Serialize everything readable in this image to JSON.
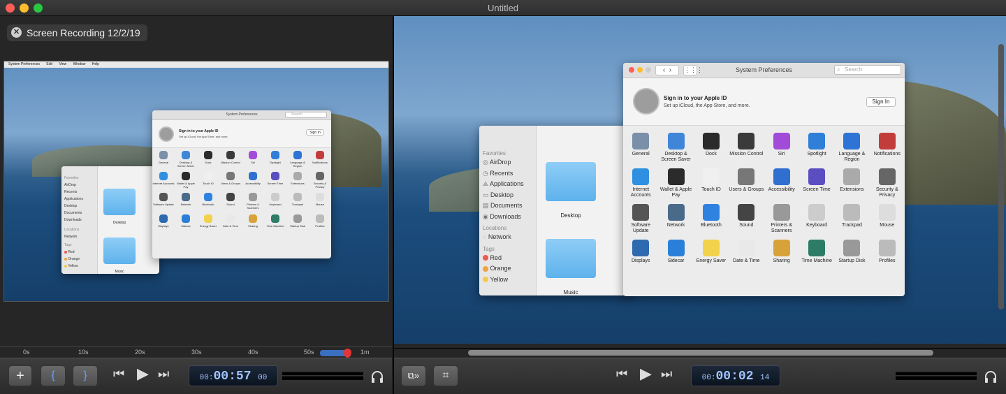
{
  "window": {
    "title": "Untitled"
  },
  "left": {
    "recording_label": "Screen Recording 12/2/19",
    "menubar": [
      "System Preferences",
      "Edit",
      "View",
      "Window",
      "Help"
    ],
    "timeline_ticks": [
      "0s",
      "10s",
      "20s",
      "30s",
      "40s",
      "50s",
      "1m"
    ],
    "timecode": {
      "prefix": "00:",
      "main": "00:57",
      "frames": "00"
    },
    "buttons": {
      "add": "+",
      "trim_start": "{",
      "trim_end": "}"
    }
  },
  "right": {
    "timecode": {
      "prefix": "00:",
      "main": "00:02",
      "frames": "14"
    }
  },
  "sysprefs": {
    "title": "System Preferences",
    "search_placeholder": "Search",
    "apple_id_title": "Sign in to your Apple ID",
    "apple_id_sub": "Set up iCloud, the App Store, and more.",
    "sign_in": "Sign In",
    "rows": [
      [
        "General",
        "Desktop & Screen Saver",
        "Dock",
        "Mission Control",
        "Siri",
        "Spotlight",
        "Language & Region",
        "Notifications"
      ],
      [
        "Internet Accounts",
        "Wallet & Apple Pay",
        "Touch ID",
        "Users & Groups",
        "Accessibility",
        "Screen Time",
        "Extensions",
        "Security & Privacy"
      ],
      [
        "Software Update",
        "Network",
        "Bluetooth",
        "Sound",
        "Printers & Scanners",
        "Keyboard",
        "Trackpad",
        "Mouse"
      ],
      [
        "Displays",
        "Sidecar",
        "Energy Saver",
        "Date & Time",
        "Sharing",
        "Time Machine",
        "Startup Disk",
        "Profiles"
      ]
    ],
    "icon_colors": [
      [
        "#7a8fa8",
        "#3f86d9",
        "#2b2b2b",
        "#3a3a3a",
        "#a24bd8",
        "#2f7fd8",
        "#2d74d6",
        "#c23c3c"
      ],
      [
        "#2f8fe0",
        "#2b2b2b",
        "#f0f0f0",
        "#777",
        "#2f6fd0",
        "#5b4ec0",
        "#aaa",
        "#666"
      ],
      [
        "#555",
        "#4a6a8a",
        "#2f82e0",
        "#444",
        "#999",
        "#ccc",
        "#bbb",
        "#ddd"
      ],
      [
        "#2d6ab0",
        "#2a80d8",
        "#f2d24a",
        "#e9e9e9",
        "#d8a23a",
        "#2c7c66",
        "#999",
        "#bbb"
      ]
    ]
  },
  "finder": {
    "favorites_header": "Favorites",
    "favorites": [
      "AirDrop",
      "Recents",
      "Applications",
      "Desktop",
      "Documents",
      "Downloads"
    ],
    "locations_header": "Locations",
    "locations": [
      "Network"
    ],
    "tags_header": "Tags",
    "tags": [
      {
        "name": "Red",
        "color": "#ee5a4f"
      },
      {
        "name": "Orange",
        "color": "#f2a33a"
      },
      {
        "name": "Yellow",
        "color": "#f5c94a"
      }
    ],
    "folders": [
      "Desktop",
      "Music"
    ]
  }
}
